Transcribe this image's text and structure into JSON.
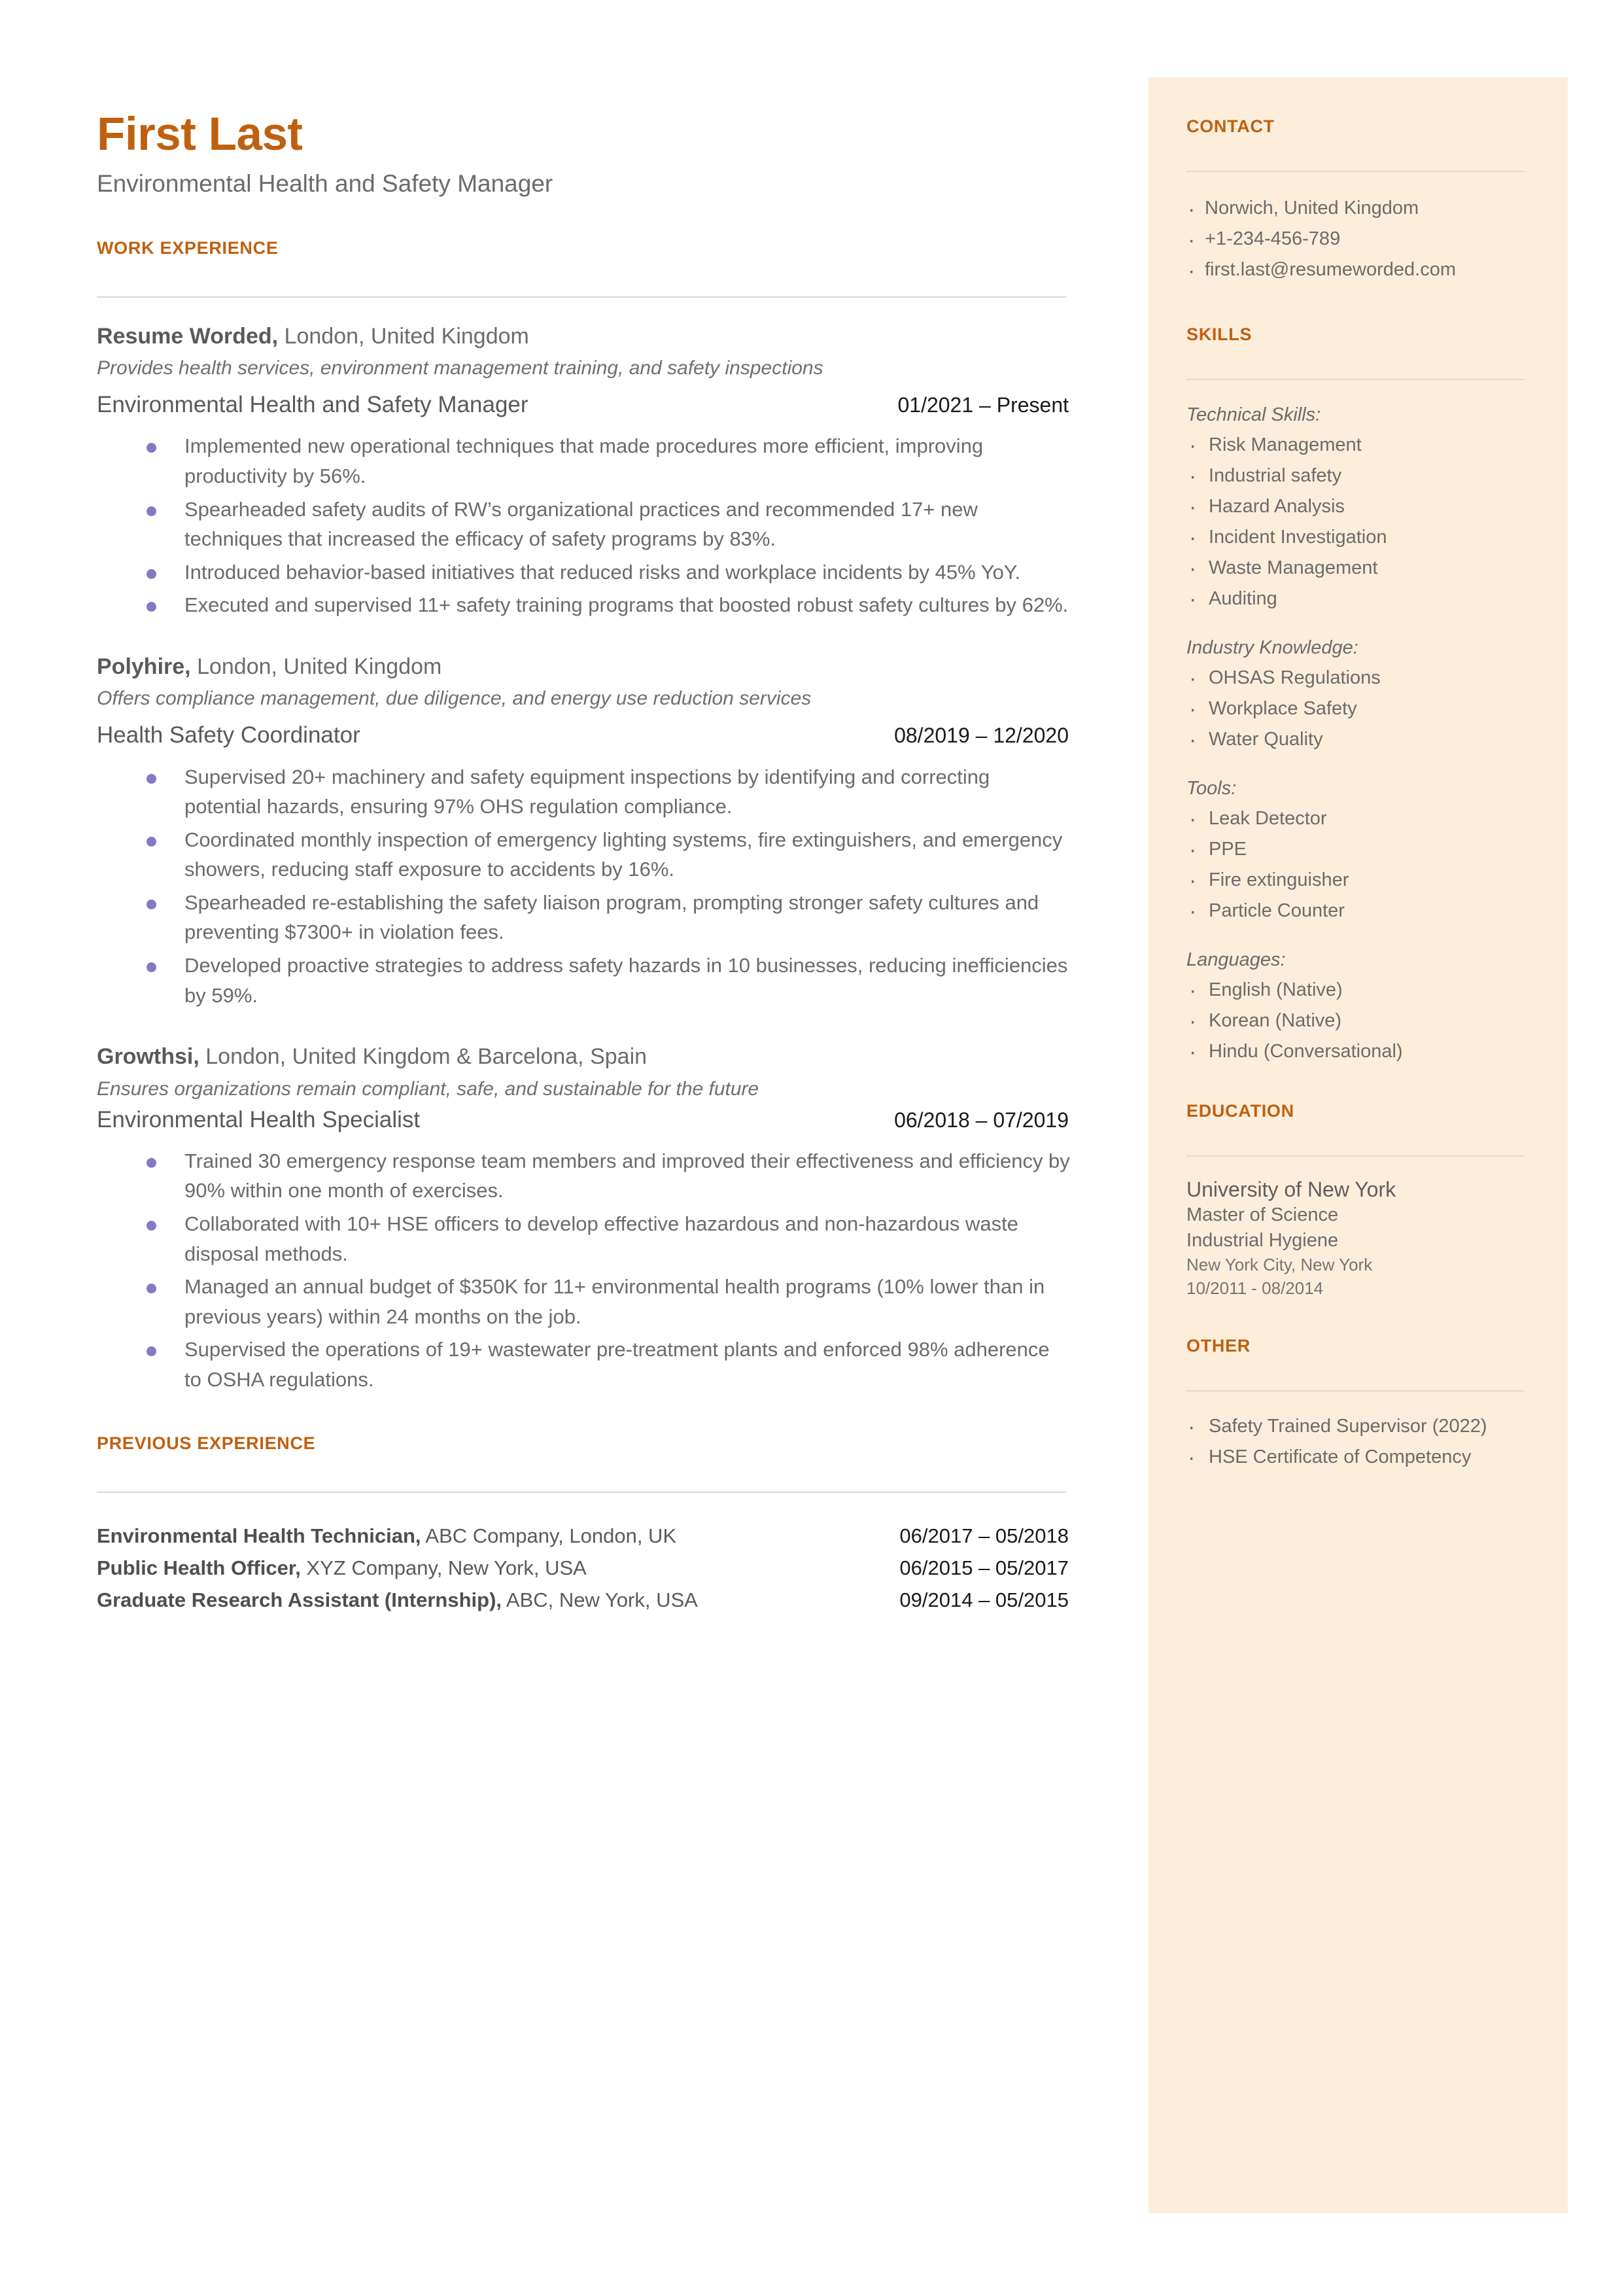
{
  "colors": {
    "accent": "#bf6010",
    "sidebar_bg": "#fdeedc",
    "bullet": "#8878c3",
    "body_text": "#6b6b6b",
    "date_text": "#1a1a1a",
    "rule": "#d9d9d9"
  },
  "header": {
    "name": "First Last",
    "title": "Environmental Health and Safety Manager"
  },
  "work_experience": {
    "heading": "WORK EXPERIENCE",
    "jobs": [
      {
        "company": "Resume Worded,",
        "location": "London, United Kingdom",
        "description": "Provides health services, environment management training, and safety inspections",
        "role": "Environmental Health and Safety Manager",
        "dates": "01/2021 – Present",
        "bullets": [
          "Implemented new operational techniques that made procedures more efficient, improving productivity by 56%.",
          "Spearheaded safety audits of RW’s organizational practices and recommended 17+ new techniques that increased the efficacy of safety programs by 83%.",
          "Introduced behavior-based initiatives that reduced risks and workplace incidents by 45% YoY.",
          "Executed and supervised 11+ safety training programs that boosted robust safety cultures by 62%."
        ]
      },
      {
        "company": "Polyhire,",
        "location": "London, United Kingdom",
        "description": "Offers compliance management, due diligence, and energy use reduction services",
        "role": "Health Safety Coordinator",
        "dates": "08/2019 – 12/2020",
        "bullets": [
          "Supervised 20+ machinery and safety equipment inspections by identifying and correcting potential hazards, ensuring 97% OHS regulation compliance.",
          "Coordinated monthly inspection of emergency lighting systems, fire extinguishers, and emergency showers, reducing staff exposure to accidents by 16%.",
          "Spearheaded re-establishing the safety liaison program, prompting stronger safety cultures and preventing $7300+ in violation fees.",
          "Developed proactive strategies to address safety hazards in 10 businesses, reducing inefficiencies by 59%."
        ]
      },
      {
        "company": "Growthsi,",
        "location": "London, United Kingdom & Barcelona, Spain",
        "description": "Ensures organizations remain compliant, safe, and sustainable for the future",
        "role": "Environmental Health Specialist",
        "dates": "06/2018 – 07/2019",
        "bullets": [
          "Trained 30 emergency response team members and improved their effectiveness and efficiency by 90% within one month of exercises.",
          "Collaborated with 10+ HSE officers to develop effective hazardous and non-hazardous waste disposal methods.",
          "Managed an annual budget of $350K for 11+ environmental health programs (10% lower than in previous years) within 24 months on the job.",
          "Supervised the operations of 19+ wastewater pre-treatment plants and enforced 98% adherence to OSHA regulations."
        ]
      }
    ]
  },
  "previous_experience": {
    "heading": "PREVIOUS EXPERIENCE",
    "rows": [
      {
        "title": "Environmental Health Technician,",
        "detail": " ABC Company, London, UK",
        "dates": "06/2017 – 05/2018"
      },
      {
        "title": "Public Health Officer,",
        "detail": " XYZ Company, New York, USA",
        "dates": "06/2015 – 05/2017"
      },
      {
        "title": "Graduate Research Assistant (Internship),",
        "detail": " ABC, New York, USA",
        "dates": "09/2014 – 05/2015"
      }
    ]
  },
  "contact": {
    "heading": "CONTACT",
    "items": [
      "Norwich, United Kingdom",
      "+1-234-456-789",
      "first.last@resumeworded.com"
    ]
  },
  "skills": {
    "heading": "SKILLS",
    "groups": [
      {
        "label": "Technical Skills:",
        "items": [
          "Risk Management",
          "Industrial safety",
          "Hazard Analysis",
          "Incident Investigation",
          "Waste Management",
          "Auditing"
        ]
      },
      {
        "label": "Industry Knowledge:",
        "items": [
          "OHSAS Regulations",
          "Workplace Safety",
          "Water Quality"
        ]
      },
      {
        "label": "Tools:",
        "items": [
          "Leak Detector",
          "PPE",
          "Fire extinguisher",
          "Particle Counter"
        ]
      },
      {
        "label": "Languages:",
        "items": [
          "English (Native)",
          "Korean (Native)",
          "Hindu (Conversational)"
        ]
      }
    ]
  },
  "education": {
    "heading": "EDUCATION",
    "school": "University of New York",
    "degree": "Master of Science",
    "field": "Industrial Hygiene",
    "location": "New York City, New York",
    "dates": "10/2011 - 08/2014"
  },
  "other": {
    "heading": "OTHER",
    "items": [
      "Safety Trained Supervisor (2022)",
      "HSE Certificate of Competency"
    ]
  }
}
